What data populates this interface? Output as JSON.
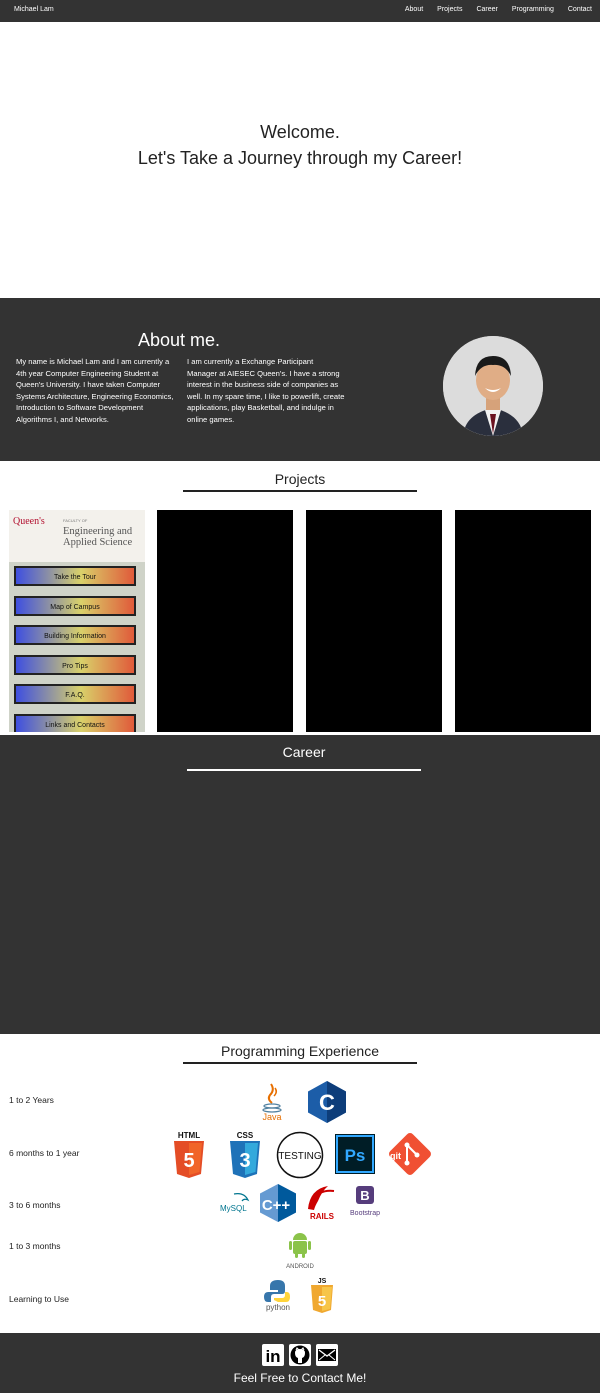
{
  "nav": {
    "brand": "Michael Lam",
    "links": [
      "About",
      "Projects",
      "Career",
      "Programming",
      "Contact"
    ]
  },
  "hero": {
    "line1": "Welcome.",
    "line2": "Let's Take a Journey through my Career!"
  },
  "about": {
    "title": "About me.",
    "col1": "My name is Michael Lam and I am currently a 4th year Computer Engineering Student at Queen's University. I have taken Computer Systems Architecture, Engineering Economics, Introduction to Software Development Algorithms I, and Networks.",
    "col2": "I am currently a Exchange Participant Manager at AIESEC Queen's. I have a strong interest in the business side of companies as well. In my spare time, I like to powerlift, create applications, play Basketball, and indulge in online games."
  },
  "projects": {
    "title": "Projects",
    "queens_app": {
      "logo": "Queen's",
      "faculty_small": "FACULTY OF",
      "faculty": "Engineering and Applied Science",
      "buttons": [
        "Take the Tour",
        "Map of Campus",
        "Building Information",
        "Pro Tips",
        "F.A.Q.",
        "Links and Contacts"
      ]
    }
  },
  "career": {
    "title": "Career"
  },
  "programming": {
    "title": "Programming Experience",
    "levels": [
      "1 to 2 Years",
      "6 months to 1 year",
      "3 to 6 months",
      "1 to 3 months",
      "Learning to Use"
    ],
    "icons": {
      "java": "Java",
      "html": "HTML",
      "css": "CSS",
      "testing": "TESTING",
      "ps": "Ps",
      "git": "git",
      "mysql": "MySQL",
      "rails": "RAILS",
      "bootstrap": "Bootstrap",
      "bootstrap_letter": "B",
      "android": "ANDROID",
      "python": "python",
      "js": "JS",
      "c": "C",
      "cpp": "C++",
      "html_num": "5",
      "css_num": "3"
    }
  },
  "footer": {
    "contact_text": "Feel Free to Contact Me!",
    "linkedin": "in"
  },
  "colors": {
    "dark_bg": "#333333",
    "c_blue": "#1c5da8",
    "html_orange": "#e44d26",
    "css_blue": "#1e72b8",
    "ps_blue": "#31a8ff",
    "git_red": "#f05033",
    "rails_red": "#cc0000",
    "bootstrap_purple": "#563d7c",
    "android_green": "#8bc34a",
    "js_yellow": "#f0a830"
  }
}
